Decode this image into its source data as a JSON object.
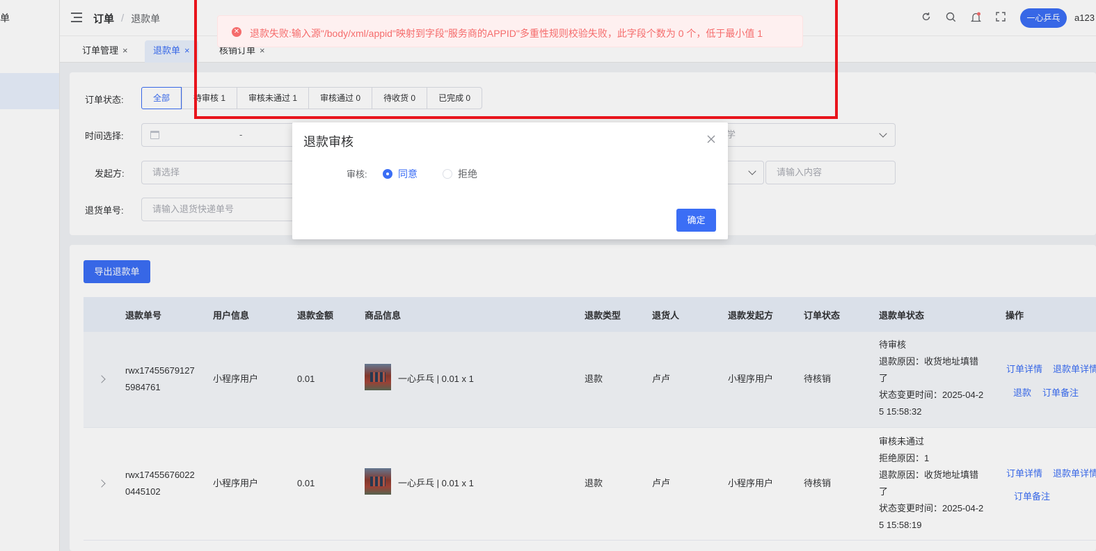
{
  "sidebar": {
    "logo_text": "单"
  },
  "header": {
    "breadcrumb": [
      "订单",
      "/",
      "退款单"
    ],
    "icons": [
      "refresh-icon",
      "search-icon",
      "bell-icon",
      "fullscreen-icon"
    ],
    "user_chip": "一心乒乓",
    "user_name": "a123"
  },
  "tabs": [
    {
      "label": "订单管理",
      "close": "×"
    },
    {
      "label": "退款单",
      "close": "×"
    },
    {
      "label": "核销订单",
      "close": "×"
    }
  ],
  "filters": {
    "status_label": "订单状态:",
    "status_options": [
      "全部",
      "待审核 1",
      "审核未通过 1",
      "审核通过 0",
      "待收货 0",
      "已完成 0"
    ],
    "time_label": "时间选择:",
    "time_separator": "-",
    "initiator_label": "发起方:",
    "initiator_placeholder": "请选择",
    "keyword_placeholder": "请输入内容",
    "partial_select_text": "学",
    "return_no_label": "退货单号:",
    "return_no_placeholder": "请输入退货快递单号"
  },
  "list": {
    "export_button": "导出退款单",
    "columns": [
      "退款单号",
      "用户信息",
      "退款金额",
      "商品信息",
      "退款类型",
      "退货人",
      "退款发起方",
      "订单状态",
      "退款单状态",
      "操作"
    ],
    "rows": [
      {
        "refund_no": [
          "rwx17455679127",
          "5984761"
        ],
        "user": "小程序用户",
        "amount": "0.01",
        "product": "一心乒乓 | 0.01 x 1",
        "type": "退款",
        "returner": "卢卢",
        "initiator": "小程序用户",
        "order_status": "待核销",
        "refund_status": [
          "待审核",
          "退款原因：收货地址填错",
          "了",
          "状态变更时间：2025-04-2",
          "5 15:58:32"
        ],
        "actions": [
          "订单详情",
          "退款单详情",
          "退款",
          "订单备注"
        ]
      },
      {
        "refund_no": [
          "rwx17455676022",
          "0445102"
        ],
        "user": "小程序用户",
        "amount": "0.01",
        "product": "一心乒乓 | 0.01 x 1",
        "type": "退款",
        "returner": "卢卢",
        "initiator": "小程序用户",
        "order_status": "待核销",
        "refund_status": [
          "审核未通过",
          "拒绝原因：1",
          "退款原因：收货地址填错",
          "了",
          "状态变更时间：2025-04-2",
          "5 15:58:19"
        ],
        "actions": [
          "订单详情",
          "退款单详情",
          "订单备注"
        ]
      }
    ]
  },
  "modal": {
    "title": "退款审核",
    "field_label": "审核:",
    "options": [
      "同意",
      "拒绝"
    ],
    "selected": "同意",
    "confirm": "确定"
  },
  "toast": {
    "message": "退款失败:输入源\"/body/xml/appid\"映射到字段\"服务商的APPID\"多重性规则校验失败，此字段个数为 0 个，低于最小值 1"
  },
  "colors": {
    "primary": "#3b6ef5",
    "error": "#f56c6c",
    "annotation": "#e8141c"
  }
}
